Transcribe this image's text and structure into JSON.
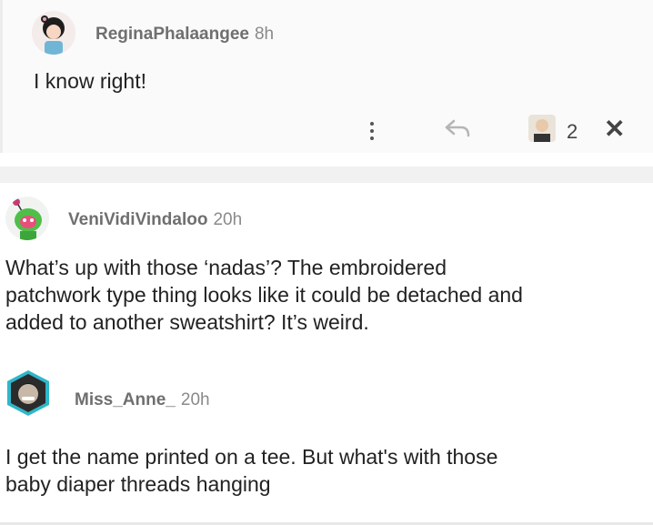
{
  "comments": [
    {
      "username": "ReginaPhalaangee",
      "time": "8h",
      "text": "I know right!",
      "reaction_count": "2",
      "avatar_icon": "girl-avatar-icon"
    },
    {
      "username": "VeniVidiVindaloo",
      "time": "20h",
      "text": "What’s up with those ‘nadas’? The embroidered\npatchwork type thing looks like it could be detached and\nadded to another sweatshirt? It’s weird.",
      "avatar_icon": "alien-avatar-icon"
    },
    {
      "username": "Miss_Anne_",
      "time": "20h",
      "text": "I get the name printed on a tee. But what's with those\nbaby diaper threads hanging",
      "avatar_icon": "hexagon-avatar-icon"
    }
  ],
  "actions": {
    "more_icon": "more-vertical-icon",
    "reply_icon": "reply-arrow-icon",
    "close_glyph": "✕"
  }
}
